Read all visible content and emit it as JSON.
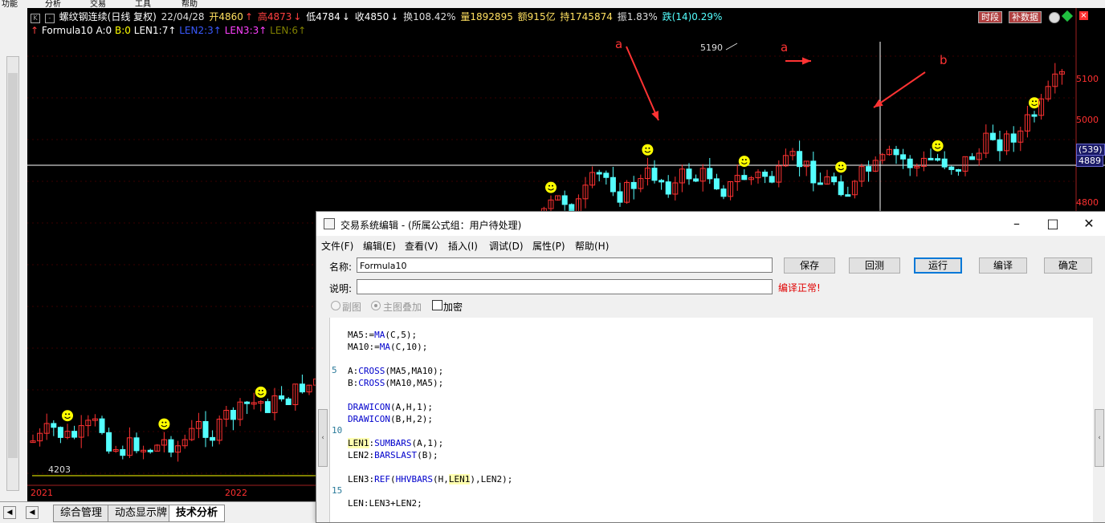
{
  "top_menu": {
    "items": [
      "功能",
      "分析",
      "交易",
      "工具",
      "帮助"
    ]
  },
  "chart": {
    "header": {
      "title": "螺纹钢连续(日线 复权)",
      "date": "22/04/28",
      "open": "开4860",
      "high": "高4873",
      "low": "低4784",
      "close": "收4850",
      "turnover": "换108.42%",
      "volume": "量1892895",
      "amount": "额915亿",
      "hold": "持1745874",
      "amplitude": "振1.83%",
      "change": "跌(14)0.29%"
    },
    "formula_line": {
      "name": "Formula10",
      "a": "A:0",
      "b": "B:0",
      "len1": "LEN1:7",
      "len2": "LEN2:3",
      "len3": "LEN3:3",
      "len": "LEN:6"
    },
    "buttons": {
      "period": "时段",
      "supplement": "补数据"
    },
    "price_axis": [
      "5100",
      "5000",
      "4900",
      "4800"
    ],
    "crosshair_tag": "(539)",
    "crosshair_price": "4889",
    "peak_label": "5190",
    "low_label": "4203",
    "years": [
      "2021",
      "2022"
    ],
    "annotations": [
      "a",
      "a",
      "b"
    ],
    "colors": {
      "up": "#ff3232",
      "down": "#54ffff",
      "signal": "#ffff00",
      "arrow": "#ff3333"
    }
  },
  "tabs": [
    "综合管理",
    "动态显示牌",
    "技术分析"
  ],
  "editor": {
    "title": "交易系统编辑 - (所属公式组：用户待处理)",
    "menu": [
      "文件(F)",
      "编辑(E)",
      "查看(V)",
      "插入(I)",
      "调试(D)",
      "属性(P)",
      "帮助(H)"
    ],
    "name_label": "名称:",
    "name_value": "Formula10",
    "desc_label": "说明:",
    "desc_value": "",
    "status": "编译正常!",
    "buttons": {
      "save": "保存",
      "backtest": "回测",
      "run": "运行",
      "compile": "编译",
      "ok": "确定"
    },
    "options": {
      "sub": "副图",
      "main": "主图叠加",
      "encrypt": "加密"
    },
    "line_numbers": [
      "5",
      "10",
      "15"
    ],
    "code": [
      "MA5:=MA(C,5);",
      "MA10:=MA(C,10);",
      "",
      "A:CROSS(MA5,MA10);",
      "B:CROSS(MA10,MA5);",
      "",
      "DRAWICON(A,H,1);",
      "DRAWICON(B,H,2);",
      "",
      "LEN1:SUMBARS(A,1);",
      "LEN2:BARSLAST(B);",
      "",
      "LEN3:REF(HHVBARS(H,LEN1),LEN2);",
      "",
      "LEN:LEN3+LEN2;"
    ]
  }
}
